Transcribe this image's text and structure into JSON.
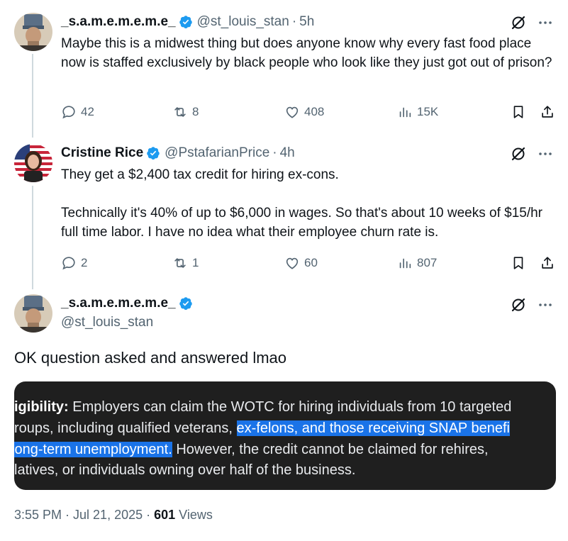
{
  "reply1": {
    "display_name": "_s.a.m.e.m.e.m.e_",
    "handle": "@st_louis_stan",
    "time": "5h",
    "text": "Maybe this is a midwest thing but does anyone know why every fast food place now is staffed exclusively by black people who look like they just got out of prison?",
    "replies": "42",
    "reposts": "8",
    "likes": "408",
    "views": "15K"
  },
  "reply2": {
    "display_name": "Cristine Rice",
    "handle": "@PstafarianPrice",
    "time": "4h",
    "text_p1": "They get a $2,400 tax credit for hiring ex-cons.",
    "text_p2": "Technically it's 40% of up to $6,000 in wages. So that's about 10 weeks of $15/hr full time labor. I have no idea what their employee churn rate is.",
    "replies": "2",
    "reposts": "1",
    "likes": "60",
    "views": "807"
  },
  "main": {
    "display_name": "_s.a.m.e.m.e.m.e_",
    "handle": "@st_louis_stan",
    "text": "OK question asked and answered lmao",
    "timestamp": "3:55 PM · Jul 21, 2025 · ",
    "views_count": "601",
    "views_label": " Views"
  },
  "media": {
    "line1_bold": "igibility:",
    "line1_rest": " Employers can claim the WOTC for hiring individuals from 10 targeted",
    "line2_plain": "roups, including qualified veterans, ",
    "line2_hl": "ex-felons, and those receiving SNAP benefi",
    "line3_hl": " long-term unemployment.",
    "line3_rest": " However, the credit cannot be claimed for rehires,",
    "line4": "latives, or individuals owning over half of the business."
  },
  "icons": {
    "verified_color": "#1d9bf0",
    "accent_text": "#536471",
    "highlight_color": "#1a73e8",
    "names": [
      "verified-badge-icon",
      "grok-icon",
      "more-icon",
      "reply-icon",
      "repost-icon",
      "like-icon",
      "views-icon",
      "bookmark-icon",
      "share-icon"
    ]
  }
}
